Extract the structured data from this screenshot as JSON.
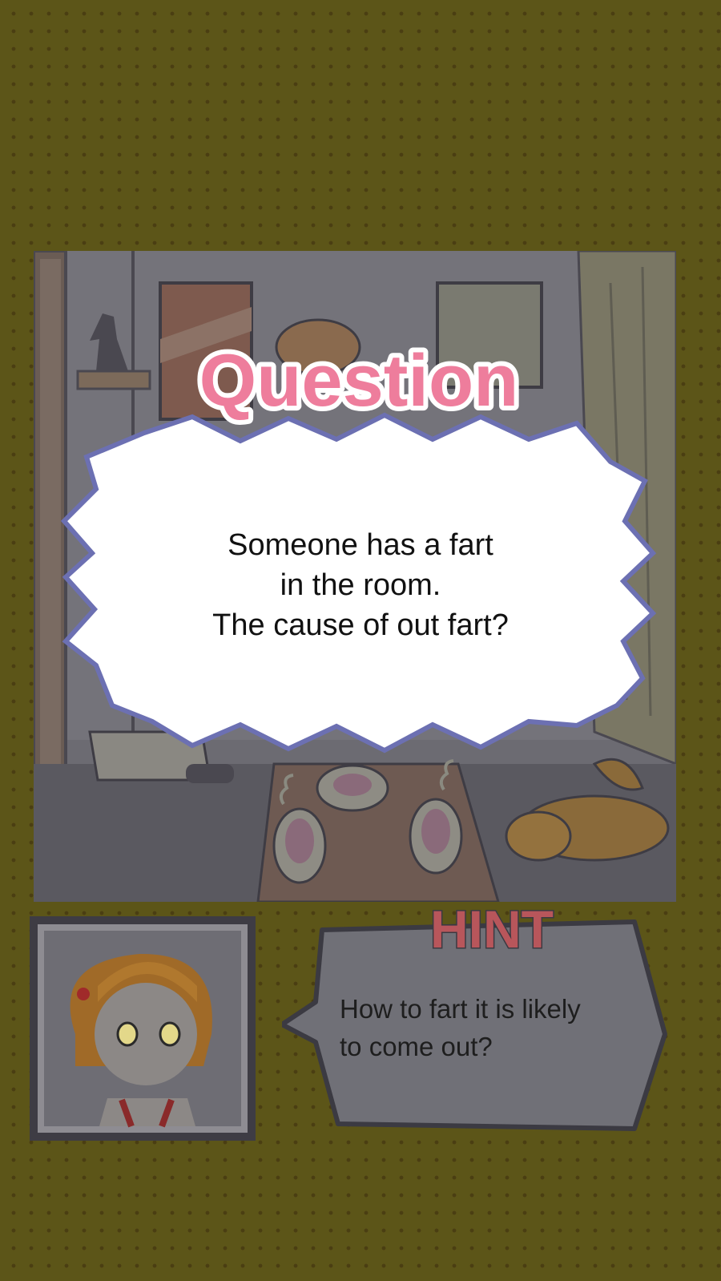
{
  "dialog": {
    "title": "Question",
    "question_text": "Someone has a fart\nin the room.\nThe cause of out fart?"
  },
  "hint": {
    "label": "HINT",
    "text": "How to fart it is likely\nto come out?"
  },
  "colors": {
    "background": "#5c5518",
    "title_pink": "#ee7d9c",
    "hint_red": "#c7585d",
    "burst_outline": "#6e73b5",
    "dim_overlay": "#3a3a44"
  },
  "icons": {
    "scene": "detective-room-illustration",
    "portrait": "girl-character-portrait",
    "dog": "sleeping-dog-icon",
    "plates": "smelly-food-plates-icon"
  }
}
